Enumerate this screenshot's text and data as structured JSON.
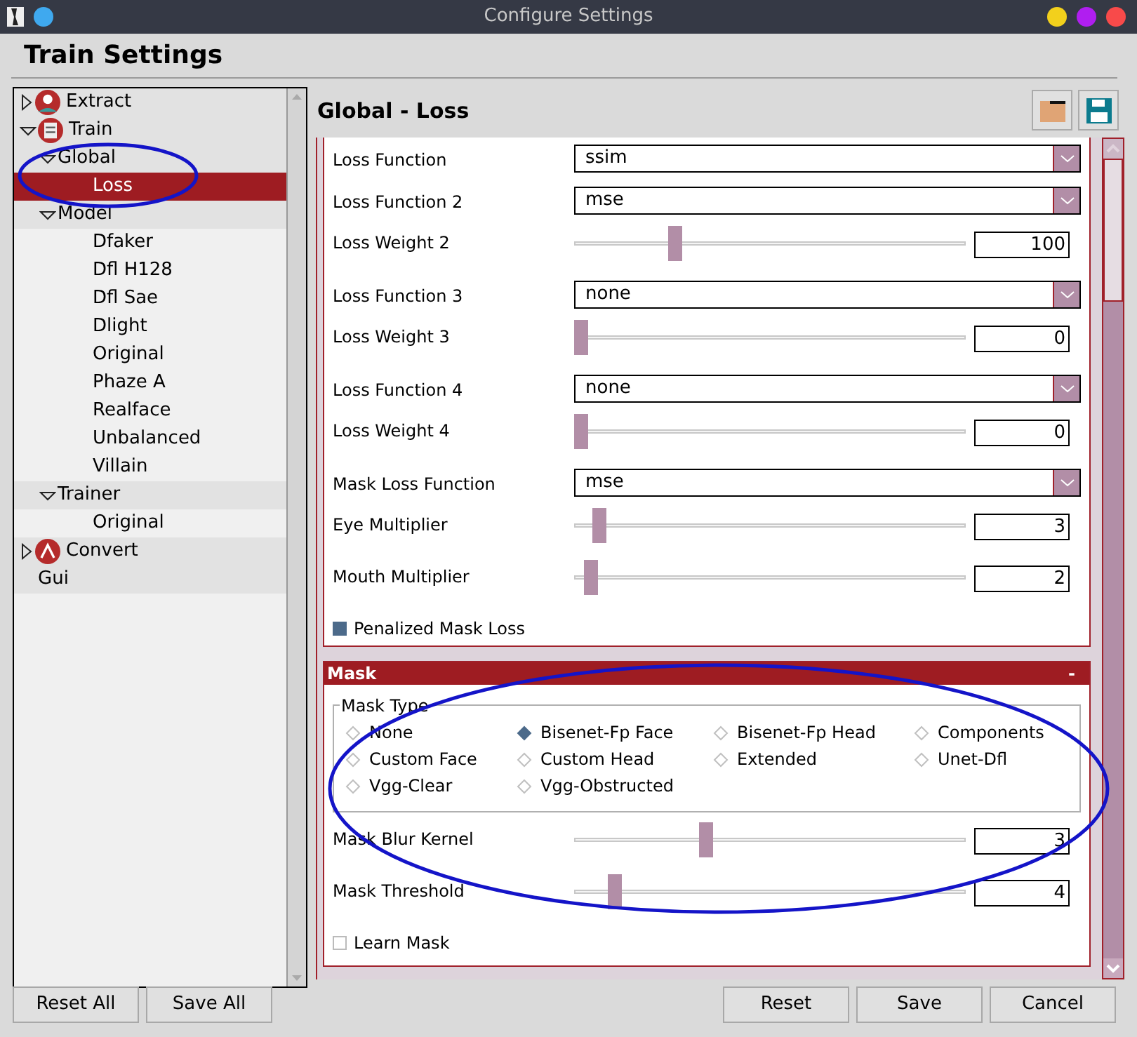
{
  "window": {
    "title": "Configure Settings"
  },
  "header": {
    "title": "Train Settings"
  },
  "tree": [
    {
      "label": "Extract",
      "expanded": false,
      "selected": false
    },
    {
      "label": "Train",
      "expanded": true,
      "selected": false,
      "children": [
        {
          "label": "Global",
          "expanded": true,
          "selected": false,
          "children": [
            {
              "label": "Loss",
              "selected": true
            }
          ]
        },
        {
          "label": "Model",
          "expanded": true,
          "selected": false,
          "children": [
            {
              "label": "Dfaker",
              "selected": false
            },
            {
              "label": "Dfl H128",
              "selected": false
            },
            {
              "label": "Dfl Sae",
              "selected": false
            },
            {
              "label": "Dlight",
              "selected": false
            },
            {
              "label": "Original",
              "selected": false
            },
            {
              "label": "Phaze A",
              "selected": false
            },
            {
              "label": "Realface",
              "selected": false
            },
            {
              "label": "Unbalanced",
              "selected": false
            },
            {
              "label": "Villain",
              "selected": false
            }
          ]
        },
        {
          "label": "Trainer",
          "expanded": true,
          "selected": false,
          "children": [
            {
              "label": "Original",
              "selected": false
            }
          ]
        }
      ]
    },
    {
      "label": "Convert",
      "expanded": false,
      "selected": false
    },
    {
      "label": "Gui",
      "selected": false
    }
  ],
  "panel": {
    "title": "Global - Loss"
  },
  "loss_settings": [
    {
      "kind": "select",
      "label": "Loss Function",
      "value": "ssim"
    },
    {
      "kind": "select",
      "label": "Loss Function 2",
      "value": "mse"
    },
    {
      "kind": "slider",
      "label": "Loss Weight 2",
      "level": 0.25,
      "value": "100"
    },
    {
      "kind": "select",
      "label": "Loss Function 3",
      "value": "none"
    },
    {
      "kind": "slider",
      "label": "Loss Weight 3",
      "level": 0,
      "value": "0"
    },
    {
      "kind": "select",
      "label": "Loss Function 4",
      "value": "none"
    },
    {
      "kind": "slider",
      "label": "Loss Weight 4",
      "level": 0,
      "value": "0"
    },
    {
      "kind": "select",
      "label": "Mask Loss Function",
      "value": "mse"
    },
    {
      "kind": "slider",
      "label": "Eye Multiplier",
      "level": 0.05,
      "value": "3"
    },
    {
      "kind": "slider",
      "label": "Mouth Multiplier",
      "level": 0.025,
      "value": "2"
    },
    {
      "kind": "checkbox",
      "label": "Penalized Mask Loss",
      "checked": true
    }
  ],
  "mask_section": {
    "title": "Mask",
    "collapse": "-",
    "group_label": "Mask Type",
    "options": [
      {
        "label": "None",
        "selected": false
      },
      {
        "label": "Bisenet-Fp Face",
        "selected": true
      },
      {
        "label": "Bisenet-Fp Head",
        "selected": false
      },
      {
        "label": "Components",
        "selected": false
      },
      {
        "label": "Custom Face",
        "selected": false
      },
      {
        "label": "Custom Head",
        "selected": false
      },
      {
        "label": "Extended",
        "selected": false
      },
      {
        "label": "Unet-Dfl",
        "selected": false
      },
      {
        "label": "Vgg-Clear",
        "selected": false
      },
      {
        "label": "Vgg-Obstructed",
        "selected": false
      }
    ],
    "settings": [
      {
        "kind": "slider",
        "label": "Mask Blur Kernel",
        "level": 0.33,
        "value": "3"
      },
      {
        "kind": "slider",
        "label": "Mask Threshold",
        "level": 0.09,
        "value": "4"
      },
      {
        "kind": "checkbox",
        "label": "Learn Mask",
        "checked": false
      }
    ]
  },
  "left_buttons": [
    "Reset All",
    "Save All"
  ],
  "right_buttons": [
    "Reset",
    "Save",
    "Cancel"
  ]
}
